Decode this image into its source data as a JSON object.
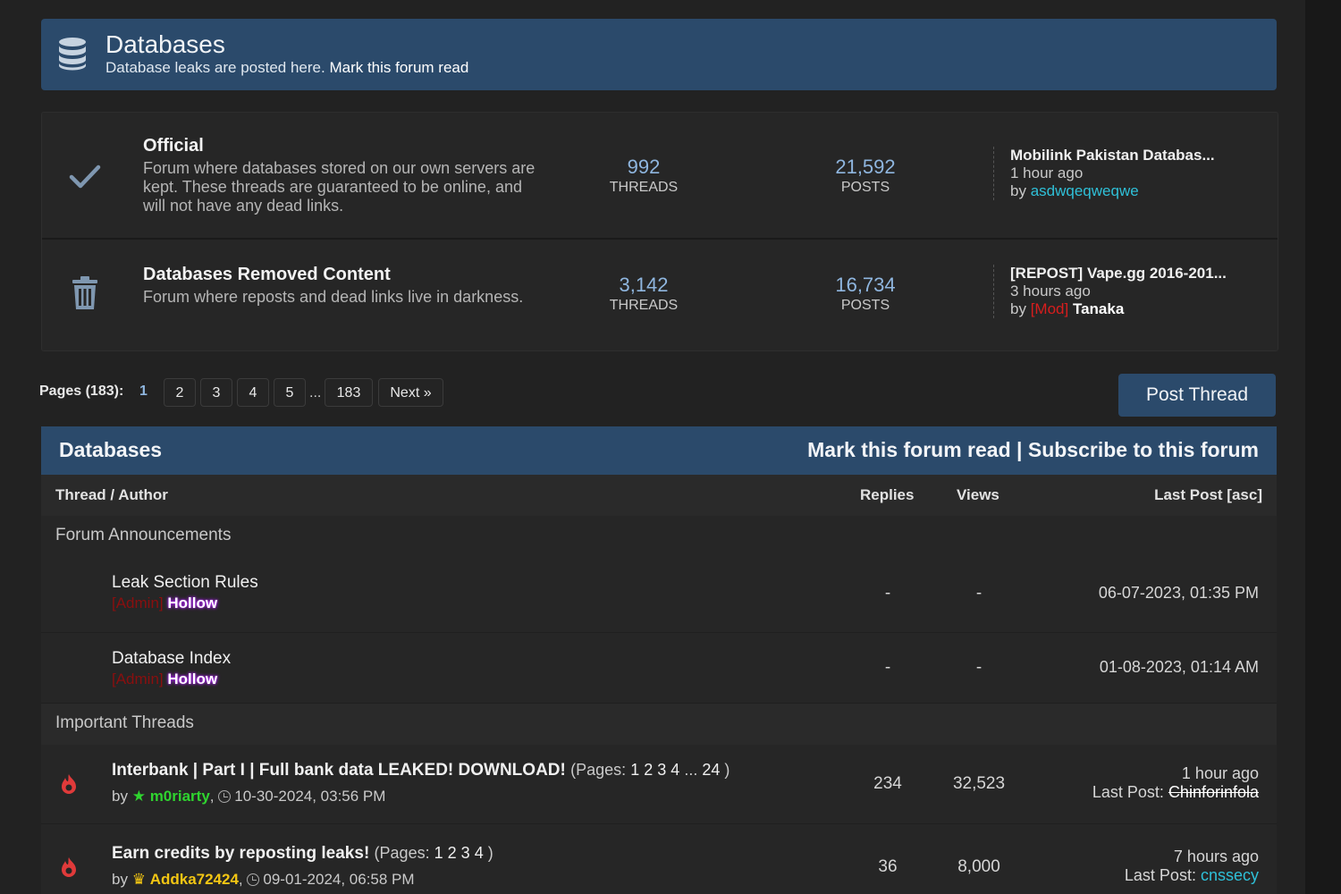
{
  "forum": {
    "title": "Databases",
    "description": "Database leaks are posted here.",
    "mark_read": "Mark this forum read"
  },
  "subforums": [
    {
      "name": "Official",
      "description": "Forum where databases stored on our own servers are kept. These threads are guaranteed to be online, and will not have any dead links.",
      "threads": "992",
      "threads_label": "THREADS",
      "posts": "21,592",
      "posts_label": "POSTS",
      "last_title": "Mobilink Pakistan Databas...",
      "last_time": "1 hour ago",
      "by": "by",
      "last_user": "asdwqeqweqwe",
      "icon": "check-icon"
    },
    {
      "name": "Databases Removed Content",
      "description": "Forum where reposts and dead links live in darkness.",
      "threads": "3,142",
      "threads_label": "THREADS",
      "posts": "16,734",
      "posts_label": "POSTS",
      "last_title": "[REPOST] Vape.gg 2016-201...",
      "last_time": "3 hours ago",
      "by": "by",
      "last_user_tag": "[Mod]",
      "last_user": "Tanaka",
      "icon": "trash-icon"
    }
  ],
  "pagination": {
    "label": "Pages (183):",
    "current": "1",
    "pages": [
      "2",
      "3",
      "4",
      "5"
    ],
    "ellipsis": "...",
    "last": "183",
    "next": "Next »"
  },
  "post_thread": "Post Thread",
  "table": {
    "title": "Databases",
    "mark_read": "Mark this forum read",
    "separator": "|",
    "subscribe": "Subscribe to this forum",
    "col_thread": "Thread / Author",
    "col_replies": "Replies",
    "col_views": "Views",
    "col_last": "Last Post [asc]"
  },
  "announcements": {
    "label": "Forum Announcements",
    "rows": [
      {
        "title": "Leak Section Rules",
        "author_tag": "[Admin]",
        "author": "Hollow",
        "replies": "-",
        "views": "-",
        "last": "06-07-2023, 01:35 PM"
      },
      {
        "title": "Database Index",
        "author_tag": "[Admin]",
        "author": "Hollow",
        "replies": "-",
        "views": "-",
        "last": "01-08-2023, 01:14 AM"
      }
    ]
  },
  "important": {
    "label": "Important Threads",
    "rows": [
      {
        "title": "Interbank | Part I | Full bank data LEAKED! DOWNLOAD!",
        "pages_prefix": "(Pages:",
        "pages": [
          "1",
          "2",
          "3",
          "4"
        ],
        "pages_ellipsis": "...",
        "pages_last": "24",
        "pages_suffix": ")",
        "by": "by",
        "author": "m0riarty",
        "comma": ",",
        "date": "10-30-2024, 03:56 PM",
        "replies": "234",
        "views": "32,523",
        "last_time": "1 hour ago",
        "last_label": "Last Post:",
        "last_user": "Chinforinfola"
      },
      {
        "title": "Earn credits by reposting leaks!",
        "pages_prefix": "(Pages:",
        "pages": [
          "1",
          "2",
          "3",
          "4"
        ],
        "pages_suffix": ")",
        "by": "by",
        "author": "Addka72424",
        "comma": ",",
        "date": "09-01-2024, 06:58 PM",
        "replies": "36",
        "views": "8,000",
        "last_time": "7 hours ago",
        "last_label": "Last Post:",
        "last_user": "cnssecy"
      }
    ]
  }
}
